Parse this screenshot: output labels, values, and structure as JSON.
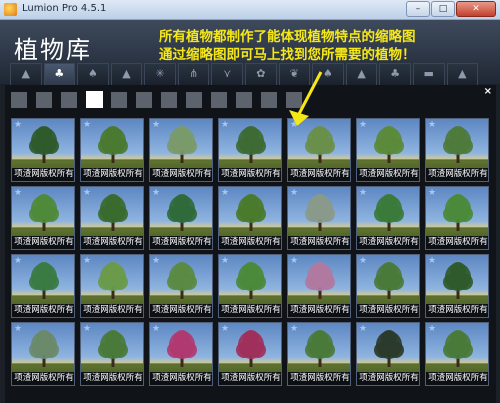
{
  "window": {
    "title": "Lumion Pro 4.5.1",
    "minimize": "–",
    "maximize": "□",
    "close": "✕"
  },
  "header": {
    "library_title": "植物库",
    "annotation_line1": "所有植物都制作了能体现植物特点的缩略图",
    "annotation_line2": "通过缩略图即可马上找到您所需要的植物！"
  },
  "tabs": [
    {
      "icon": "tree-icon",
      "glyph": "▲"
    },
    {
      "icon": "deciduous-tree-icon",
      "glyph": "♣"
    },
    {
      "icon": "bush-icon",
      "glyph": "♠"
    },
    {
      "icon": "conifer-icon",
      "glyph": "▲"
    },
    {
      "icon": "palm-icon",
      "glyph": "✳"
    },
    {
      "icon": "grass-icon",
      "glyph": "⋔"
    },
    {
      "icon": "plant-icon",
      "glyph": "⋎"
    },
    {
      "icon": "flower-icon",
      "glyph": "✿"
    },
    {
      "icon": "leaf-icon",
      "glyph": "❦"
    },
    {
      "icon": "shrub-icon",
      "glyph": "♠"
    },
    {
      "icon": "tall-tree-icon",
      "glyph": "▲"
    },
    {
      "icon": "tree-group-icon",
      "glyph": "♣"
    },
    {
      "icon": "hedge-icon",
      "glyph": "▬"
    },
    {
      "icon": "forest-icon",
      "glyph": "▲"
    }
  ],
  "subcategories": {
    "count": 12,
    "active_index": 3,
    "close_label": "×"
  },
  "grid": {
    "caption": "项渣网版权所有",
    "star": "★",
    "rows": 4,
    "cols": 7,
    "tree_colors": [
      "#2f5a2a",
      "#4a7a30",
      "#7a9a6a",
      "#3d6a32",
      "#6a8f4a",
      "#5a8a3a",
      "#4e7a3c",
      "#4f8a3a",
      "#3a6a2e",
      "#2f6a3a",
      "#4a7a2a",
      "#8a9a8a",
      "#3a7a3a",
      "#4a8a3a",
      "#3a7a42",
      "#6a9a4a",
      "#5a8a42",
      "#4a8a3a",
      "#b07aa0",
      "#4a7a3a",
      "#2f5a2a",
      "#6a8a6a",
      "#4a7a3a",
      "#b03a70",
      "#a0305a",
      "#4a7a3a",
      "#2a3a2a",
      "#4a7a3a"
    ]
  }
}
